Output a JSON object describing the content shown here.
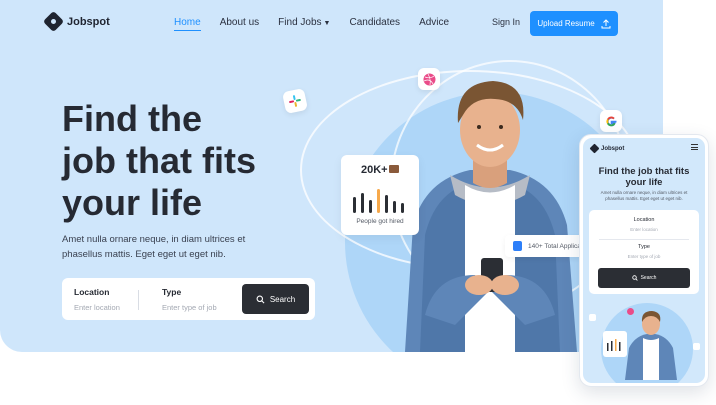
{
  "brand": {
    "name": "Jobspot"
  },
  "nav": {
    "items": [
      {
        "label": "Home",
        "active": true
      },
      {
        "label": "About us",
        "active": false
      },
      {
        "label": "Find Jobs",
        "active": false,
        "has_dropdown": true
      },
      {
        "label": "Candidates",
        "active": false
      },
      {
        "label": "Advice",
        "active": false
      }
    ],
    "sign_in": "Sign In",
    "upload_resume": "Upload Resume"
  },
  "hero": {
    "headline_line1": "Find the",
    "headline_line2": "job that fits",
    "headline_line3": "your life",
    "subtitle": "Amet nulla ornare neque, in diam ultrices et phasellus mattis. Eget eget ut eget nib."
  },
  "search": {
    "location_label": "Location",
    "location_placeholder": "Enter location",
    "type_label": "Type",
    "type_placeholder": "Enter type of job",
    "button_label": "Search"
  },
  "stats": {
    "count": "20K+",
    "label": "People got hired"
  },
  "applicants": {
    "label": "140+ Total Applicants"
  },
  "mobile": {
    "brand": "Jobspot",
    "title": "Find the job that fits your life",
    "subtitle": "Amet nulla ornare neque, in diam ultrices et phasellus mattis. Eget eget ut eget nib.",
    "location_label": "Location",
    "location_placeholder": "Enter location",
    "type_label": "Type",
    "type_placeholder": "Enter type of job",
    "button_label": "Search"
  },
  "colors": {
    "accent": "#1e90ff",
    "hero_bg": "#cfe6fb",
    "dark": "#2b2e34",
    "bar_orange": "#f7a94b"
  },
  "icons": [
    "slack-icon",
    "dribbble-icon",
    "google-icon",
    "search-icon",
    "upload-icon",
    "briefcase-icon",
    "document-icon",
    "menu-icon"
  ]
}
